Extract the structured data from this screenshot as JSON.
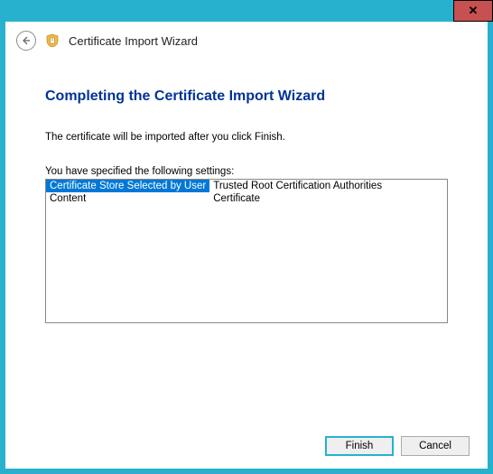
{
  "titlebar": {
    "close_symbol": "✕"
  },
  "header": {
    "title": "Certificate Import Wizard"
  },
  "main": {
    "heading": "Completing the Certificate Import Wizard",
    "intro": "The certificate will be imported after you click Finish.",
    "settings_label": "You have specified the following settings:",
    "rows": [
      {
        "key": "Certificate Store Selected by User",
        "value": "Trusted Root Certification Authorities",
        "selected": true
      },
      {
        "key": "Content",
        "value": "Certificate",
        "selected": false
      }
    ]
  },
  "footer": {
    "finish_label": "Finish",
    "cancel_label": "Cancel"
  }
}
